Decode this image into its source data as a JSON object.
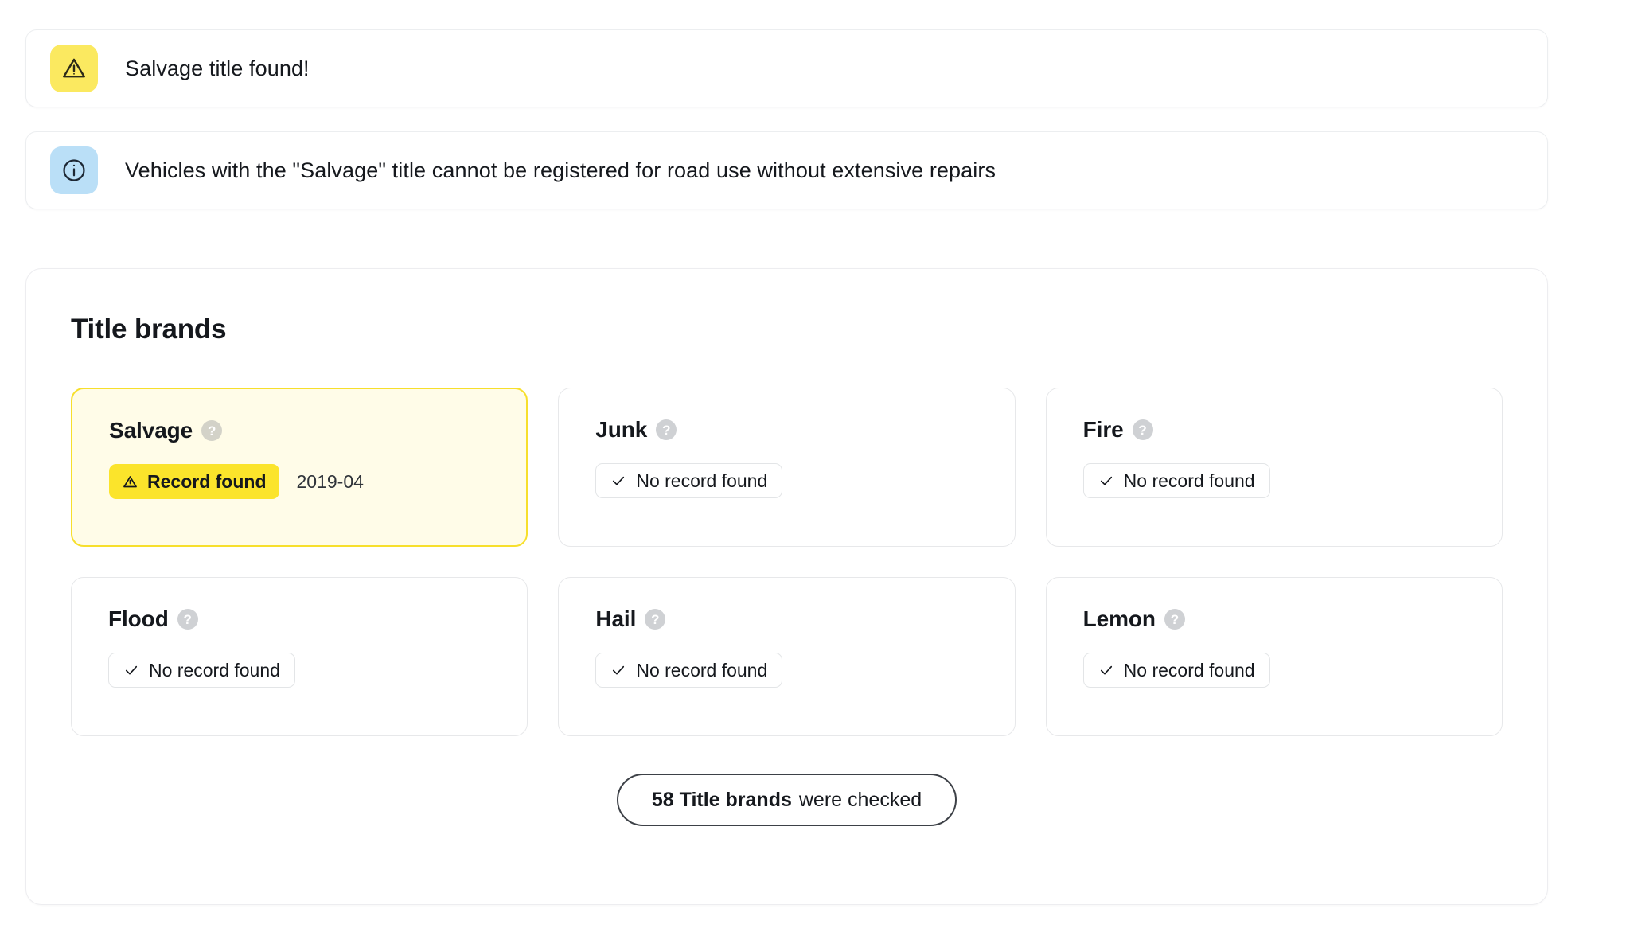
{
  "banners": [
    {
      "id": "salvage-title-found",
      "icon": "warning-triangle-icon",
      "icon_bg": "#FBE960",
      "text": "Salvage title found!"
    },
    {
      "id": "salvage-info",
      "icon": "info-circle-icon",
      "icon_bg": "#BADFF7",
      "text": "Vehicles with the \"Salvage\" title cannot be registered for road use without extensive repairs"
    }
  ],
  "panel": {
    "title": "Title brands",
    "help_glyph": "?",
    "cards": [
      {
        "name": "Salvage",
        "status": "Record found",
        "status_type": "found",
        "date": "2019-04",
        "status_icon": "warning-triangle-icon"
      },
      {
        "name": "Junk",
        "status": "No record found",
        "status_type": "none",
        "status_icon": "check-icon"
      },
      {
        "name": "Fire",
        "status": "No record found",
        "status_type": "none",
        "status_icon": "check-icon"
      },
      {
        "name": "Flood",
        "status": "No record found",
        "status_type": "none",
        "status_icon": "check-icon"
      },
      {
        "name": "Hail",
        "status": "No record found",
        "status_type": "none",
        "status_icon": "check-icon"
      },
      {
        "name": "Lemon",
        "status": "No record found",
        "status_type": "none",
        "status_icon": "check-icon"
      }
    ],
    "footer": {
      "count_label": "58 Title brands",
      "suffix": "were checked"
    }
  },
  "colors": {
    "warning_yellow": "#FBE960",
    "badge_yellow": "#FBE42B",
    "found_card_bg": "#FFFCE8",
    "found_card_border": "#F7DF2C",
    "info_blue": "#BADFF7",
    "text_primary": "#15181d"
  }
}
